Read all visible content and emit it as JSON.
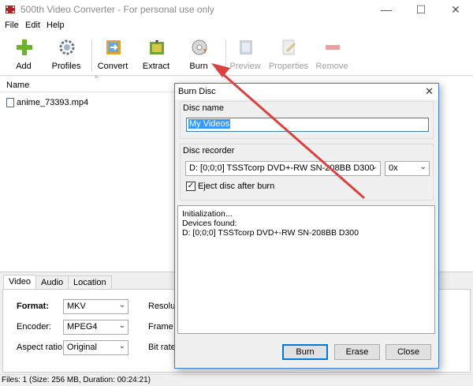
{
  "window": {
    "title": "500th Video Converter - For personal use only",
    "controls": {
      "minimize": "—",
      "maximize": "☐",
      "close": "✕"
    }
  },
  "menu": [
    "File",
    "Edit",
    "Help"
  ],
  "toolbar": {
    "add": "Add",
    "profiles": "Profiles",
    "convert": "Convert",
    "extract": "Extract",
    "burn": "Burn",
    "preview": "Preview",
    "properties": "Properties",
    "remove": "Remove"
  },
  "filelist": {
    "column_name": "Name",
    "files": [
      "anime_73393.mp4"
    ]
  },
  "bottom_tabs": [
    "Video",
    "Audio",
    "Location"
  ],
  "properties": {
    "format_label": "Format:",
    "format_value": "MKV",
    "encoder_label": "Encoder:",
    "encoder_value": "MPEG4",
    "aspect_label": "Aspect ratio:",
    "aspect_value": "Original",
    "resolution_label": "Resoluti",
    "framerate_label": "Frame r",
    "bitrate_label": "Bit rate:"
  },
  "status": "Files: 1 (Size: 256 MB, Duration: 00:24:21)",
  "dialog": {
    "title": "Burn Disc",
    "disc_name_label": "Disc name",
    "disc_name_value": "My Videos",
    "disc_recorder_label": "Disc recorder",
    "recorder_value": "D:  [0;0;0] TSSTcorp DVD+-RW SN-208BB D300",
    "speed_value": "0x",
    "eject_label": "Eject disc after burn",
    "log_lines": [
      "Initialization...",
      "Devices found:",
      "D:  [0;0;0] TSSTcorp DVD+-RW SN-208BB D300"
    ],
    "burn_button": "Burn",
    "erase_button": "Erase",
    "close_button": "Close"
  },
  "colors": {
    "annotation_arrow": "#d9423f",
    "dialog_border": "#3b7fd4",
    "selection": "#3399ff"
  }
}
